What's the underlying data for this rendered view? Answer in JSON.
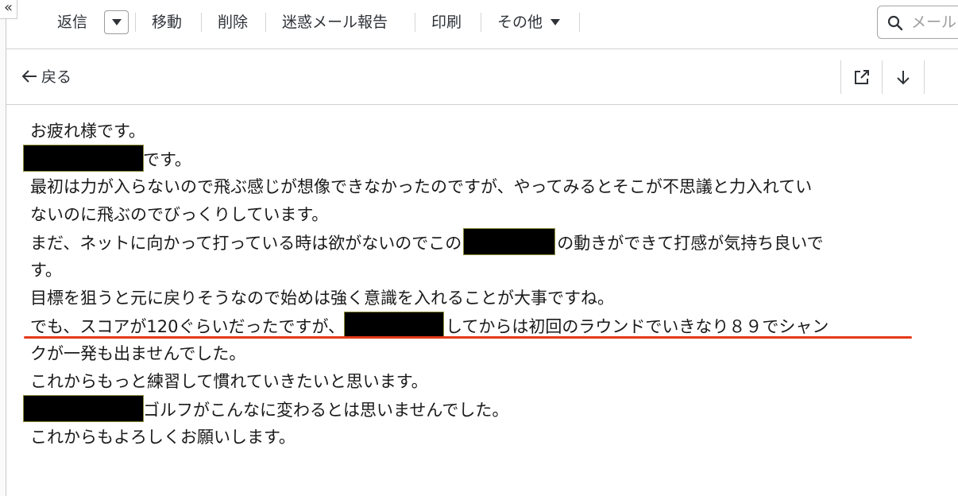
{
  "sidebar": {
    "collapse_label": "«"
  },
  "toolbar": {
    "reply_label": "返信",
    "move_label": "移動",
    "delete_label": "削除",
    "spam_label": "迷惑メール報告",
    "print_label": "印刷",
    "more_label": "その他",
    "search_placeholder": "メール"
  },
  "message_bar": {
    "back_label": "戻る",
    "icons": [
      "open-in-new-window-icon",
      "download-arrow-icon"
    ]
  },
  "message": {
    "lines": [
      "お疲れ様です。",
      "です。",
      "最初は力が入らないので飛ぶ感じが想像できなかったのですが、やってみるとそこが不思議と力入れてい",
      "ないのに飛ぶのでびっくりしています。",
      "まだ、ネットに向かって打っている時は欲がないのでこの",
      "の動きができて打感が気持ち良いで",
      "す。",
      "目標を狙うと元に戻りそうなので始めは強く意識を入れることが大事ですね。",
      "でも、スコアが120ぐらいだったですが、",
      "してからは初回のラウンドでいきなり８９でシャン",
      "クが一発も出ませんでした。",
      "これからもっと練習して慣れていきたいと思います。",
      "ゴルフがこんなに変わるとは思いませんでした。",
      "これからもよろしくお願いします。"
    ],
    "highlight_color": "#e53a19",
    "redaction_color": "#000000"
  }
}
